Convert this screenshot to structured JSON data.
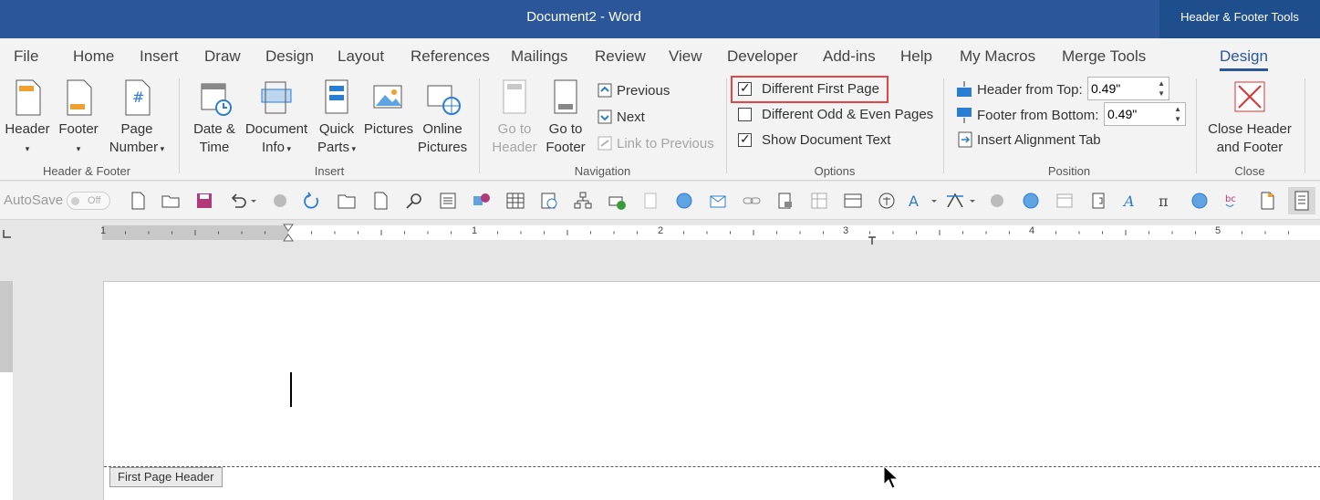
{
  "title": {
    "document": "Document2  -  Word",
    "context_tools": "Header & Footer Tools"
  },
  "tabs": [
    "File",
    "Home",
    "Insert",
    "Draw",
    "Design",
    "Layout",
    "References",
    "Mailings",
    "Review",
    "View",
    "Developer",
    "Add-ins",
    "Help",
    "My Macros",
    "Merge Tools",
    "Design"
  ],
  "ribbon": {
    "header_footer": {
      "label": "Header & Footer",
      "header": "Header",
      "footer": "Footer",
      "page_number_1": "Page",
      "page_number_2": "Number"
    },
    "insert": {
      "label": "Insert",
      "date_time_1": "Date &",
      "date_time_2": "Time",
      "doc_info_1": "Document",
      "doc_info_2": "Info",
      "quick_parts_1": "Quick",
      "quick_parts_2": "Parts",
      "pictures": "Pictures",
      "online_pictures_1": "Online",
      "online_pictures_2": "Pictures"
    },
    "navigation": {
      "label": "Navigation",
      "go_to_header_1": "Go to",
      "go_to_header_2": "Header",
      "go_to_footer_1": "Go to",
      "go_to_footer_2": "Footer",
      "previous": "Previous",
      "next": "Next",
      "link_to_previous": "Link to Previous"
    },
    "options": {
      "label": "Options",
      "different_first_page": "Different First Page",
      "different_odd_even": "Different Odd & Even Pages",
      "show_document_text": "Show Document Text",
      "different_first_page_checked": true,
      "different_odd_even_checked": false,
      "show_document_text_checked": true
    },
    "position": {
      "label": "Position",
      "header_from_top": "Header from Top:",
      "header_from_top_value": "0.49\"",
      "footer_from_bottom": "Footer from Bottom:",
      "footer_from_bottom_value": "0.49\"",
      "insert_alignment_tab": "Insert Alignment Tab"
    },
    "close": {
      "label": "Close",
      "close_1": "Close Header",
      "close_2": "and Footer"
    }
  },
  "qat": {
    "autosave": "AutoSave",
    "toggle": "Off"
  },
  "ruler": {
    "numbers": [
      "1",
      "1",
      "2",
      "3",
      "4",
      "5"
    ]
  },
  "document": {
    "header_tag": "First Page Header"
  },
  "colors": {
    "titlebar": "#2b579a",
    "accent": "#2b579a",
    "highlight": "#e04848"
  }
}
